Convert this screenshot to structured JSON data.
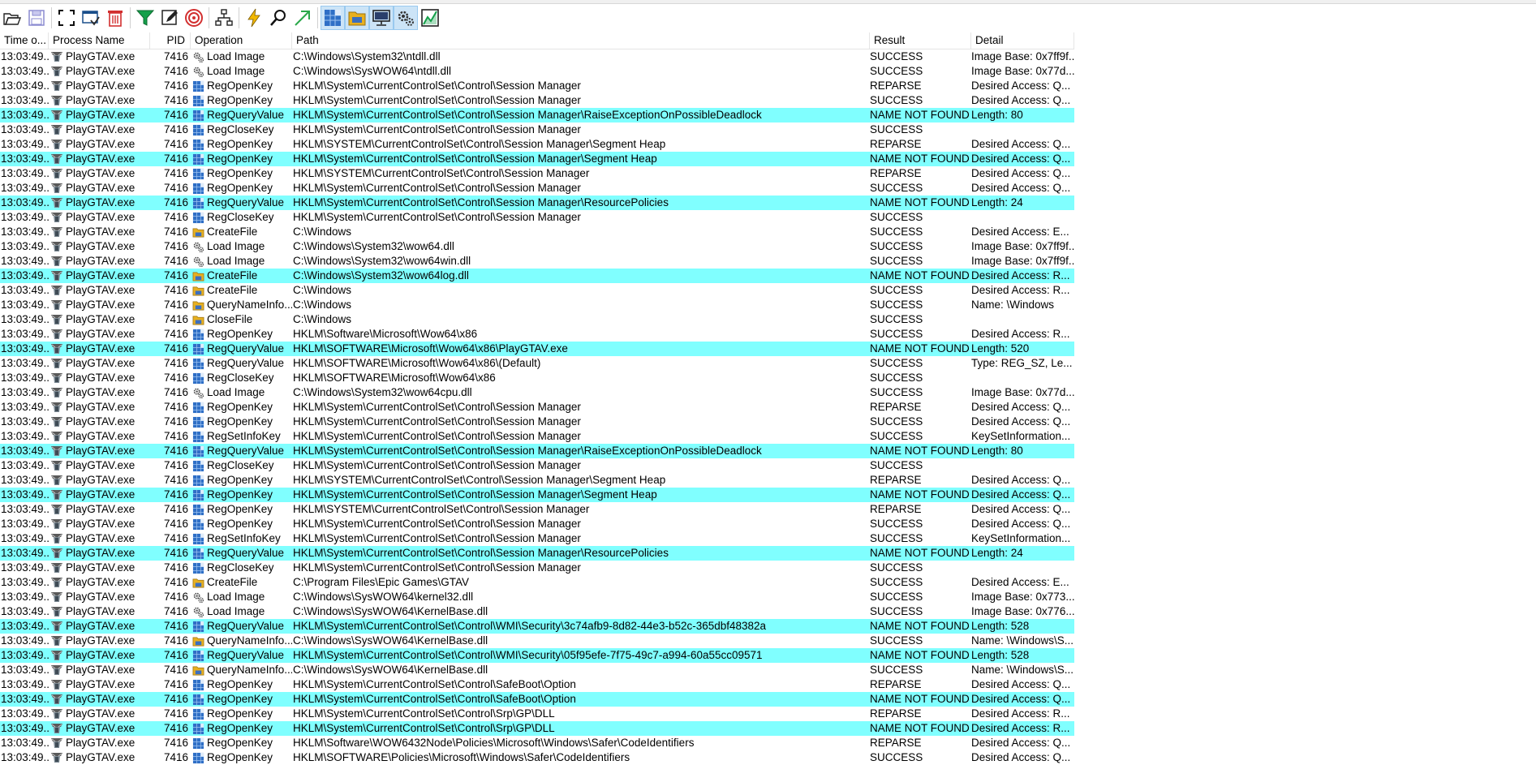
{
  "toolbar": {
    "buttons": [
      {
        "name": "open-icon"
      },
      {
        "name": "save-icon"
      },
      {
        "sep": true
      },
      {
        "name": "autoscroll-icon"
      },
      {
        "name": "capture-icon"
      },
      {
        "name": "clear-icon"
      },
      {
        "sep": true
      },
      {
        "name": "filter-icon"
      },
      {
        "name": "highlight-icon"
      },
      {
        "name": "include-process-icon"
      },
      {
        "sep": true
      },
      {
        "name": "process-tree-icon"
      },
      {
        "sep": true
      },
      {
        "name": "event-properties-icon"
      },
      {
        "name": "find-icon"
      },
      {
        "name": "jump-to-icon"
      },
      {
        "sep": true
      },
      {
        "name": "registry-activity-icon",
        "active": true
      },
      {
        "name": "filesystem-activity-icon",
        "active": true
      },
      {
        "name": "network-activity-icon",
        "active": true
      },
      {
        "name": "process-thread-activity-icon",
        "active": true
      },
      {
        "name": "profiling-events-icon"
      }
    ]
  },
  "columns": {
    "time": "Time o...",
    "process": "Process Name",
    "pid": "PID",
    "operation": "Operation",
    "path": "Path",
    "result": "Result",
    "detail": "Detail"
  },
  "colors": {
    "highlight": "#80ffff",
    "registry": "#2f6fc6",
    "file": "#e8b020"
  },
  "rows": [
    {
      "time": "13:03:49...",
      "process": "PlayGTAV.exe",
      "pid": "7416",
      "operation": "Load Image",
      "kind": "image",
      "path": "C:\\Windows\\System32\\ntdll.dll",
      "result": "SUCCESS",
      "detail": "Image Base: 0x7ff9f...",
      "hl": false
    },
    {
      "time": "13:03:49...",
      "process": "PlayGTAV.exe",
      "pid": "7416",
      "operation": "Load Image",
      "kind": "image",
      "path": "C:\\Windows\\SysWOW64\\ntdll.dll",
      "result": "SUCCESS",
      "detail": "Image Base: 0x77d...",
      "hl": false
    },
    {
      "time": "13:03:49...",
      "process": "PlayGTAV.exe",
      "pid": "7416",
      "operation": "RegOpenKey",
      "kind": "reg",
      "path": "HKLM\\System\\CurrentControlSet\\Control\\Session Manager",
      "result": "REPARSE",
      "detail": "Desired Access: Q...",
      "hl": false
    },
    {
      "time": "13:03:49...",
      "process": "PlayGTAV.exe",
      "pid": "7416",
      "operation": "RegOpenKey",
      "kind": "reg",
      "path": "HKLM\\System\\CurrentControlSet\\Control\\Session Manager",
      "result": "SUCCESS",
      "detail": "Desired Access: Q...",
      "hl": false
    },
    {
      "time": "13:03:49...",
      "process": "PlayGTAV.exe",
      "pid": "7416",
      "operation": "RegQueryValue",
      "kind": "reg",
      "path": "HKLM\\System\\CurrentControlSet\\Control\\Session Manager\\RaiseExceptionOnPossibleDeadlock",
      "result": "NAME NOT FOUND",
      "detail": "Length: 80",
      "hl": true
    },
    {
      "time": "13:03:49...",
      "process": "PlayGTAV.exe",
      "pid": "7416",
      "operation": "RegCloseKey",
      "kind": "reg",
      "path": "HKLM\\System\\CurrentControlSet\\Control\\Session Manager",
      "result": "SUCCESS",
      "detail": "",
      "hl": false
    },
    {
      "time": "13:03:49...",
      "process": "PlayGTAV.exe",
      "pid": "7416",
      "operation": "RegOpenKey",
      "kind": "reg",
      "path": "HKLM\\SYSTEM\\CurrentControlSet\\Control\\Session Manager\\Segment Heap",
      "result": "REPARSE",
      "detail": "Desired Access: Q...",
      "hl": false
    },
    {
      "time": "13:03:49...",
      "process": "PlayGTAV.exe",
      "pid": "7416",
      "operation": "RegOpenKey",
      "kind": "reg",
      "path": "HKLM\\System\\CurrentControlSet\\Control\\Session Manager\\Segment Heap",
      "result": "NAME NOT FOUND",
      "detail": "Desired Access: Q...",
      "hl": true
    },
    {
      "time": "13:03:49...",
      "process": "PlayGTAV.exe",
      "pid": "7416",
      "operation": "RegOpenKey",
      "kind": "reg",
      "path": "HKLM\\SYSTEM\\CurrentControlSet\\Control\\Session Manager",
      "result": "REPARSE",
      "detail": "Desired Access: Q...",
      "hl": false
    },
    {
      "time": "13:03:49...",
      "process": "PlayGTAV.exe",
      "pid": "7416",
      "operation": "RegOpenKey",
      "kind": "reg",
      "path": "HKLM\\System\\CurrentControlSet\\Control\\Session Manager",
      "result": "SUCCESS",
      "detail": "Desired Access: Q...",
      "hl": false
    },
    {
      "time": "13:03:49...",
      "process": "PlayGTAV.exe",
      "pid": "7416",
      "operation": "RegQueryValue",
      "kind": "reg",
      "path": "HKLM\\System\\CurrentControlSet\\Control\\Session Manager\\ResourcePolicies",
      "result": "NAME NOT FOUND",
      "detail": "Length: 24",
      "hl": true
    },
    {
      "time": "13:03:49...",
      "process": "PlayGTAV.exe",
      "pid": "7416",
      "operation": "RegCloseKey",
      "kind": "reg",
      "path": "HKLM\\System\\CurrentControlSet\\Control\\Session Manager",
      "result": "SUCCESS",
      "detail": "",
      "hl": false
    },
    {
      "time": "13:03:49...",
      "process": "PlayGTAV.exe",
      "pid": "7416",
      "operation": "CreateFile",
      "kind": "file",
      "path": "C:\\Windows",
      "result": "SUCCESS",
      "detail": "Desired Access: E...",
      "hl": false
    },
    {
      "time": "13:03:49...",
      "process": "PlayGTAV.exe",
      "pid": "7416",
      "operation": "Load Image",
      "kind": "image",
      "path": "C:\\Windows\\System32\\wow64.dll",
      "result": "SUCCESS",
      "detail": "Image Base: 0x7ff9f...",
      "hl": false
    },
    {
      "time": "13:03:49...",
      "process": "PlayGTAV.exe",
      "pid": "7416",
      "operation": "Load Image",
      "kind": "image",
      "path": "C:\\Windows\\System32\\wow64win.dll",
      "result": "SUCCESS",
      "detail": "Image Base: 0x7ff9f...",
      "hl": false
    },
    {
      "time": "13:03:49...",
      "process": "PlayGTAV.exe",
      "pid": "7416",
      "operation": "CreateFile",
      "kind": "file",
      "path": "C:\\Windows\\System32\\wow64log.dll",
      "result": "NAME NOT FOUND",
      "detail": "Desired Access: R...",
      "hl": true
    },
    {
      "time": "13:03:49...",
      "process": "PlayGTAV.exe",
      "pid": "7416",
      "operation": "CreateFile",
      "kind": "file",
      "path": "C:\\Windows",
      "result": "SUCCESS",
      "detail": "Desired Access: R...",
      "hl": false
    },
    {
      "time": "13:03:49...",
      "process": "PlayGTAV.exe",
      "pid": "7416",
      "operation": "QueryNameInfo...",
      "kind": "file",
      "path": "C:\\Windows",
      "result": "SUCCESS",
      "detail": "Name: \\Windows",
      "hl": false
    },
    {
      "time": "13:03:49...",
      "process": "PlayGTAV.exe",
      "pid": "7416",
      "operation": "CloseFile",
      "kind": "file",
      "path": "C:\\Windows",
      "result": "SUCCESS",
      "detail": "",
      "hl": false
    },
    {
      "time": "13:03:49...",
      "process": "PlayGTAV.exe",
      "pid": "7416",
      "operation": "RegOpenKey",
      "kind": "reg",
      "path": "HKLM\\Software\\Microsoft\\Wow64\\x86",
      "result": "SUCCESS",
      "detail": "Desired Access: R...",
      "hl": false
    },
    {
      "time": "13:03:49...",
      "process": "PlayGTAV.exe",
      "pid": "7416",
      "operation": "RegQueryValue",
      "kind": "reg",
      "path": "HKLM\\SOFTWARE\\Microsoft\\Wow64\\x86\\PlayGTAV.exe",
      "result": "NAME NOT FOUND",
      "detail": "Length: 520",
      "hl": true
    },
    {
      "time": "13:03:49...",
      "process": "PlayGTAV.exe",
      "pid": "7416",
      "operation": "RegQueryValue",
      "kind": "reg",
      "path": "HKLM\\SOFTWARE\\Microsoft\\Wow64\\x86\\(Default)",
      "result": "SUCCESS",
      "detail": "Type: REG_SZ, Le...",
      "hl": false
    },
    {
      "time": "13:03:49...",
      "process": "PlayGTAV.exe",
      "pid": "7416",
      "operation": "RegCloseKey",
      "kind": "reg",
      "path": "HKLM\\SOFTWARE\\Microsoft\\Wow64\\x86",
      "result": "SUCCESS",
      "detail": "",
      "hl": false
    },
    {
      "time": "13:03:49...",
      "process": "PlayGTAV.exe",
      "pid": "7416",
      "operation": "Load Image",
      "kind": "image",
      "path": "C:\\Windows\\System32\\wow64cpu.dll",
      "result": "SUCCESS",
      "detail": "Image Base: 0x77d...",
      "hl": false
    },
    {
      "time": "13:03:49...",
      "process": "PlayGTAV.exe",
      "pid": "7416",
      "operation": "RegOpenKey",
      "kind": "reg",
      "path": "HKLM\\System\\CurrentControlSet\\Control\\Session Manager",
      "result": "REPARSE",
      "detail": "Desired Access: Q...",
      "hl": false
    },
    {
      "time": "13:03:49...",
      "process": "PlayGTAV.exe",
      "pid": "7416",
      "operation": "RegOpenKey",
      "kind": "reg",
      "path": "HKLM\\System\\CurrentControlSet\\Control\\Session Manager",
      "result": "SUCCESS",
      "detail": "Desired Access: Q...",
      "hl": false
    },
    {
      "time": "13:03:49...",
      "process": "PlayGTAV.exe",
      "pid": "7416",
      "operation": "RegSetInfoKey",
      "kind": "reg",
      "path": "HKLM\\System\\CurrentControlSet\\Control\\Session Manager",
      "result": "SUCCESS",
      "detail": "KeySetInformation...",
      "hl": false
    },
    {
      "time": "13:03:49...",
      "process": "PlayGTAV.exe",
      "pid": "7416",
      "operation": "RegQueryValue",
      "kind": "reg",
      "path": "HKLM\\System\\CurrentControlSet\\Control\\Session Manager\\RaiseExceptionOnPossibleDeadlock",
      "result": "NAME NOT FOUND",
      "detail": "Length: 80",
      "hl": true
    },
    {
      "time": "13:03:49...",
      "process": "PlayGTAV.exe",
      "pid": "7416",
      "operation": "RegCloseKey",
      "kind": "reg",
      "path": "HKLM\\System\\CurrentControlSet\\Control\\Session Manager",
      "result": "SUCCESS",
      "detail": "",
      "hl": false
    },
    {
      "time": "13:03:49...",
      "process": "PlayGTAV.exe",
      "pid": "7416",
      "operation": "RegOpenKey",
      "kind": "reg",
      "path": "HKLM\\SYSTEM\\CurrentControlSet\\Control\\Session Manager\\Segment Heap",
      "result": "REPARSE",
      "detail": "Desired Access: Q...",
      "hl": false
    },
    {
      "time": "13:03:49...",
      "process": "PlayGTAV.exe",
      "pid": "7416",
      "operation": "RegOpenKey",
      "kind": "reg",
      "path": "HKLM\\System\\CurrentControlSet\\Control\\Session Manager\\Segment Heap",
      "result": "NAME NOT FOUND",
      "detail": "Desired Access: Q...",
      "hl": true
    },
    {
      "time": "13:03:49...",
      "process": "PlayGTAV.exe",
      "pid": "7416",
      "operation": "RegOpenKey",
      "kind": "reg",
      "path": "HKLM\\SYSTEM\\CurrentControlSet\\Control\\Session Manager",
      "result": "REPARSE",
      "detail": "Desired Access: Q...",
      "hl": false
    },
    {
      "time": "13:03:49...",
      "process": "PlayGTAV.exe",
      "pid": "7416",
      "operation": "RegOpenKey",
      "kind": "reg",
      "path": "HKLM\\System\\CurrentControlSet\\Control\\Session Manager",
      "result": "SUCCESS",
      "detail": "Desired Access: Q...",
      "hl": false
    },
    {
      "time": "13:03:49...",
      "process": "PlayGTAV.exe",
      "pid": "7416",
      "operation": "RegSetInfoKey",
      "kind": "reg",
      "path": "HKLM\\System\\CurrentControlSet\\Control\\Session Manager",
      "result": "SUCCESS",
      "detail": "KeySetInformation...",
      "hl": false
    },
    {
      "time": "13:03:49...",
      "process": "PlayGTAV.exe",
      "pid": "7416",
      "operation": "RegQueryValue",
      "kind": "reg",
      "path": "HKLM\\System\\CurrentControlSet\\Control\\Session Manager\\ResourcePolicies",
      "result": "NAME NOT FOUND",
      "detail": "Length: 24",
      "hl": true
    },
    {
      "time": "13:03:49...",
      "process": "PlayGTAV.exe",
      "pid": "7416",
      "operation": "RegCloseKey",
      "kind": "reg",
      "path": "HKLM\\System\\CurrentControlSet\\Control\\Session Manager",
      "result": "SUCCESS",
      "detail": "",
      "hl": false
    },
    {
      "time": "13:03:49...",
      "process": "PlayGTAV.exe",
      "pid": "7416",
      "operation": "CreateFile",
      "kind": "file",
      "path": "C:\\Program Files\\Epic Games\\GTAV",
      "result": "SUCCESS",
      "detail": "Desired Access: E...",
      "hl": false
    },
    {
      "time": "13:03:49...",
      "process": "PlayGTAV.exe",
      "pid": "7416",
      "operation": "Load Image",
      "kind": "image",
      "path": "C:\\Windows\\SysWOW64\\kernel32.dll",
      "result": "SUCCESS",
      "detail": "Image Base: 0x773...",
      "hl": false
    },
    {
      "time": "13:03:49...",
      "process": "PlayGTAV.exe",
      "pid": "7416",
      "operation": "Load Image",
      "kind": "image",
      "path": "C:\\Windows\\SysWOW64\\KernelBase.dll",
      "result": "SUCCESS",
      "detail": "Image Base: 0x776...",
      "hl": false
    },
    {
      "time": "13:03:49...",
      "process": "PlayGTAV.exe",
      "pid": "7416",
      "operation": "RegQueryValue",
      "kind": "reg",
      "path": "HKLM\\System\\CurrentControlSet\\Control\\WMI\\Security\\3c74afb9-8d82-44e3-b52c-365dbf48382a",
      "result": "NAME NOT FOUND",
      "detail": "Length: 528",
      "hl": true
    },
    {
      "time": "13:03:49...",
      "process": "PlayGTAV.exe",
      "pid": "7416",
      "operation": "QueryNameInfo...",
      "kind": "file",
      "path": "C:\\Windows\\SysWOW64\\KernelBase.dll",
      "result": "SUCCESS",
      "detail": "Name: \\Windows\\S...",
      "hl": false
    },
    {
      "time": "13:03:49...",
      "process": "PlayGTAV.exe",
      "pid": "7416",
      "operation": "RegQueryValue",
      "kind": "reg",
      "path": "HKLM\\System\\CurrentControlSet\\Control\\WMI\\Security\\05f95efe-7f75-49c7-a994-60a55cc09571",
      "result": "NAME NOT FOUND",
      "detail": "Length: 528",
      "hl": true
    },
    {
      "time": "13:03:49...",
      "process": "PlayGTAV.exe",
      "pid": "7416",
      "operation": "QueryNameInfo...",
      "kind": "file",
      "path": "C:\\Windows\\SysWOW64\\KernelBase.dll",
      "result": "SUCCESS",
      "detail": "Name: \\Windows\\S...",
      "hl": false
    },
    {
      "time": "13:03:49...",
      "process": "PlayGTAV.exe",
      "pid": "7416",
      "operation": "RegOpenKey",
      "kind": "reg",
      "path": "HKLM\\System\\CurrentControlSet\\Control\\SafeBoot\\Option",
      "result": "REPARSE",
      "detail": "Desired Access: Q...",
      "hl": false
    },
    {
      "time": "13:03:49...",
      "process": "PlayGTAV.exe",
      "pid": "7416",
      "operation": "RegOpenKey",
      "kind": "reg",
      "path": "HKLM\\System\\CurrentControlSet\\Control\\SafeBoot\\Option",
      "result": "NAME NOT FOUND",
      "detail": "Desired Access: Q...",
      "hl": true
    },
    {
      "time": "13:03:49...",
      "process": "PlayGTAV.exe",
      "pid": "7416",
      "operation": "RegOpenKey",
      "kind": "reg",
      "path": "HKLM\\System\\CurrentControlSet\\Control\\Srp\\GP\\DLL",
      "result": "REPARSE",
      "detail": "Desired Access: R...",
      "hl": false
    },
    {
      "time": "13:03:49...",
      "process": "PlayGTAV.exe",
      "pid": "7416",
      "operation": "RegOpenKey",
      "kind": "reg",
      "path": "HKLM\\System\\CurrentControlSet\\Control\\Srp\\GP\\DLL",
      "result": "NAME NOT FOUND",
      "detail": "Desired Access: R...",
      "hl": true
    },
    {
      "time": "13:03:49...",
      "process": "PlayGTAV.exe",
      "pid": "7416",
      "operation": "RegOpenKey",
      "kind": "reg",
      "path": "HKLM\\Software\\WOW6432Node\\Policies\\Microsoft\\Windows\\Safer\\CodeIdentifiers",
      "result": "REPARSE",
      "detail": "Desired Access: Q...",
      "hl": false
    },
    {
      "time": "13:03:49...",
      "process": "PlayGTAV.exe",
      "pid": "7416",
      "operation": "RegOpenKey",
      "kind": "reg",
      "path": "HKLM\\SOFTWARE\\Policies\\Microsoft\\Windows\\Safer\\CodeIdentifiers",
      "result": "SUCCESS",
      "detail": "Desired Access: Q...",
      "hl": false
    }
  ]
}
